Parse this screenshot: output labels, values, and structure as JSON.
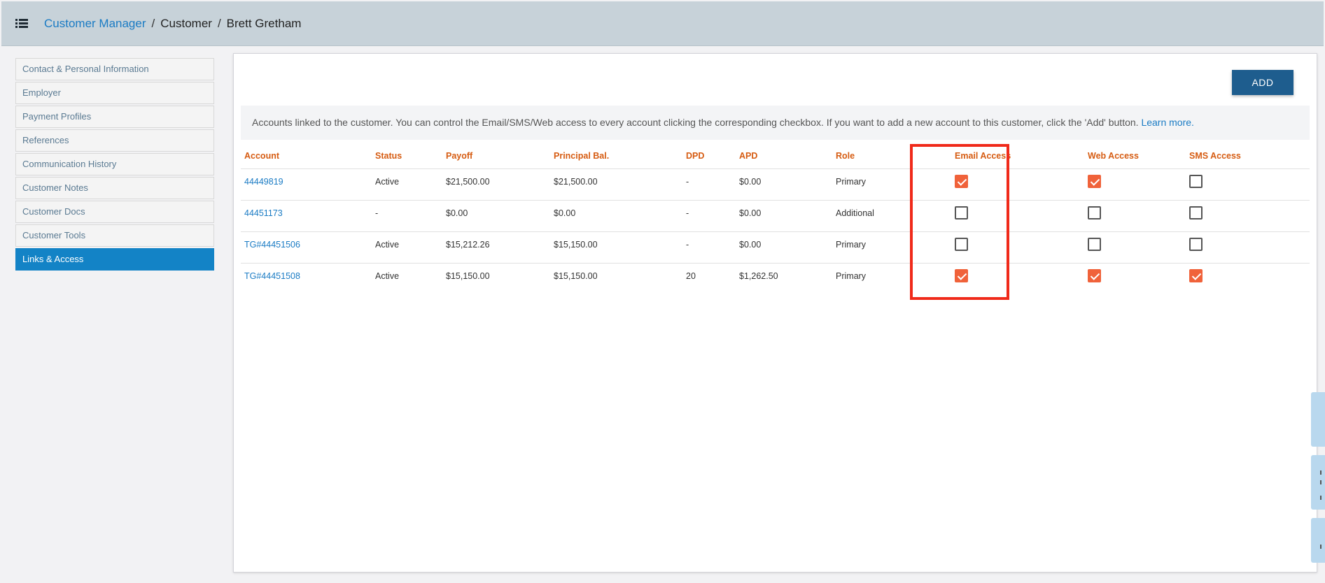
{
  "breadcrumb": {
    "root": "Customer Manager",
    "sep1": "/",
    "section": "Customer",
    "sep2": "/",
    "current": "Brett Gretham"
  },
  "sidebar": {
    "items": [
      {
        "label": "Contact & Personal Information",
        "active": false
      },
      {
        "label": "Employer",
        "active": false
      },
      {
        "label": "Payment Profiles",
        "active": false
      },
      {
        "label": "References",
        "active": false
      },
      {
        "label": "Communication History",
        "active": false
      },
      {
        "label": "Customer Notes",
        "active": false
      },
      {
        "label": "Customer Docs",
        "active": false
      },
      {
        "label": "Customer Tools",
        "active": false
      },
      {
        "label": "Links & Access",
        "active": true
      }
    ]
  },
  "main": {
    "add_label": "ADD",
    "info_text": "Accounts linked to the customer. You can control the Email/SMS/Web access to every account clicking the corresponding checkbox. If you want to add a new account to this customer, click the 'Add' button.",
    "learn_more": "Learn more.",
    "columns": [
      "Account",
      "Status",
      "Payoff",
      "Principal Bal.",
      "DPD",
      "APD",
      "Role",
      "Email Access",
      "Web Access",
      "SMS Access"
    ],
    "rows": [
      {
        "account": "44449819",
        "status": "Active",
        "payoff": "$21,500.00",
        "principal": "$21,500.00",
        "dpd": "-",
        "apd": "$0.00",
        "role": "Primary",
        "email": true,
        "web": true,
        "sms": false
      },
      {
        "account": "44451173",
        "status": "-",
        "payoff": "$0.00",
        "principal": "$0.00",
        "dpd": "-",
        "apd": "$0.00",
        "role": "Additional",
        "email": false,
        "web": false,
        "sms": false
      },
      {
        "account": "TG#44451506",
        "status": "Active",
        "payoff": "$15,212.26",
        "principal": "$15,150.00",
        "dpd": "-",
        "apd": "$0.00",
        "role": "Primary",
        "email": false,
        "web": false,
        "sms": false
      },
      {
        "account": "TG#44451508",
        "status": "Active",
        "payoff": "$15,150.00",
        "principal": "$15,150.00",
        "dpd": "20",
        "apd": "$1,262.50",
        "role": "Primary",
        "email": true,
        "web": true,
        "sms": true
      }
    ]
  },
  "colors": {
    "accent": "#1383c6",
    "header_text": "#d65c12",
    "checkbox_checked": "#f0623a",
    "highlight_box": "#f02a1a",
    "add_button": "#1e5d8e"
  },
  "icons": {
    "menu": "list-menu-icon",
    "checkbox_checked": "checkmark-icon"
  }
}
